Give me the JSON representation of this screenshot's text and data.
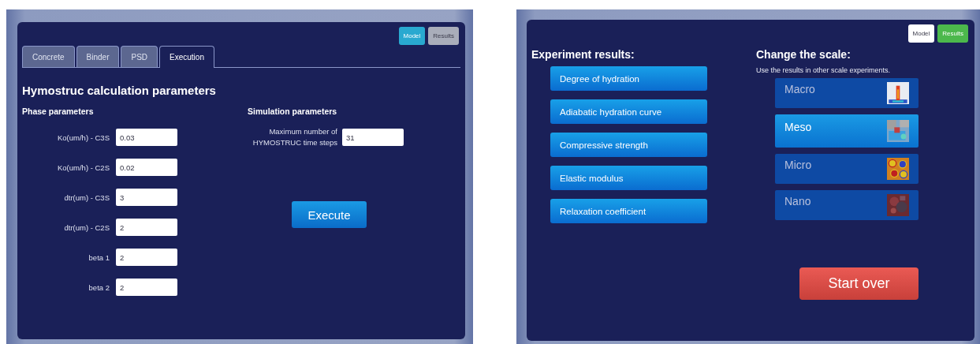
{
  "screens": [
    {
      "kind": "model",
      "mode_buttons": [
        {
          "label": "Model",
          "selected": true,
          "color": "#29a9d0"
        },
        {
          "label": "Results",
          "selected": false,
          "color": "#a9adba"
        }
      ],
      "tabs": [
        {
          "label": "Concrete",
          "selected": false
        },
        {
          "label": "Binder",
          "selected": false
        },
        {
          "label": "PSD",
          "selected": false
        },
        {
          "label": "Execution",
          "selected": true
        }
      ],
      "heading": "Hymostruc calculation parameters",
      "phase_parameters": {
        "title": "Phase parameters",
        "fields": [
          {
            "label": "Ko(um/h) - C3S",
            "value": "0.03"
          },
          {
            "label": "Ko(um/h) - C2S",
            "value": "0.02"
          },
          {
            "label": "dtr(um) - C3S",
            "value": "3"
          },
          {
            "label": "dtr(um) - C2S",
            "value": "2"
          },
          {
            "label": "beta 1",
            "value": "2"
          },
          {
            "label": "beta 2",
            "value": "2"
          }
        ]
      },
      "simulation_parameters": {
        "title": "Simulation parameters",
        "fields": [
          {
            "label": "Maximum number of HYMOSTRUC time steps",
            "value": "31"
          }
        ]
      },
      "action_button": "Execute"
    },
    {
      "kind": "results",
      "mode_buttons": [
        {
          "label": "Model",
          "selected": false,
          "color": "#ffffff"
        },
        {
          "label": "Results",
          "selected": true,
          "color": "#4cb84c"
        }
      ],
      "experiment_results": {
        "title": "Experiment results:",
        "items": [
          "Degree of hydration",
          "Adiabatic hydration curve",
          "Compressive strength",
          "Elastic modulus",
          "Relaxation coefficient"
        ]
      },
      "change_scale": {
        "title": "Change the scale:",
        "description": "Use the results in other scale experiments.",
        "items": [
          {
            "label": "Macro",
            "selected": false
          },
          {
            "label": "Meso",
            "selected": true
          },
          {
            "label": "Micro",
            "selected": false
          },
          {
            "label": "Nano",
            "selected": false
          }
        ]
      },
      "start_over_button": "Start over"
    }
  ]
}
